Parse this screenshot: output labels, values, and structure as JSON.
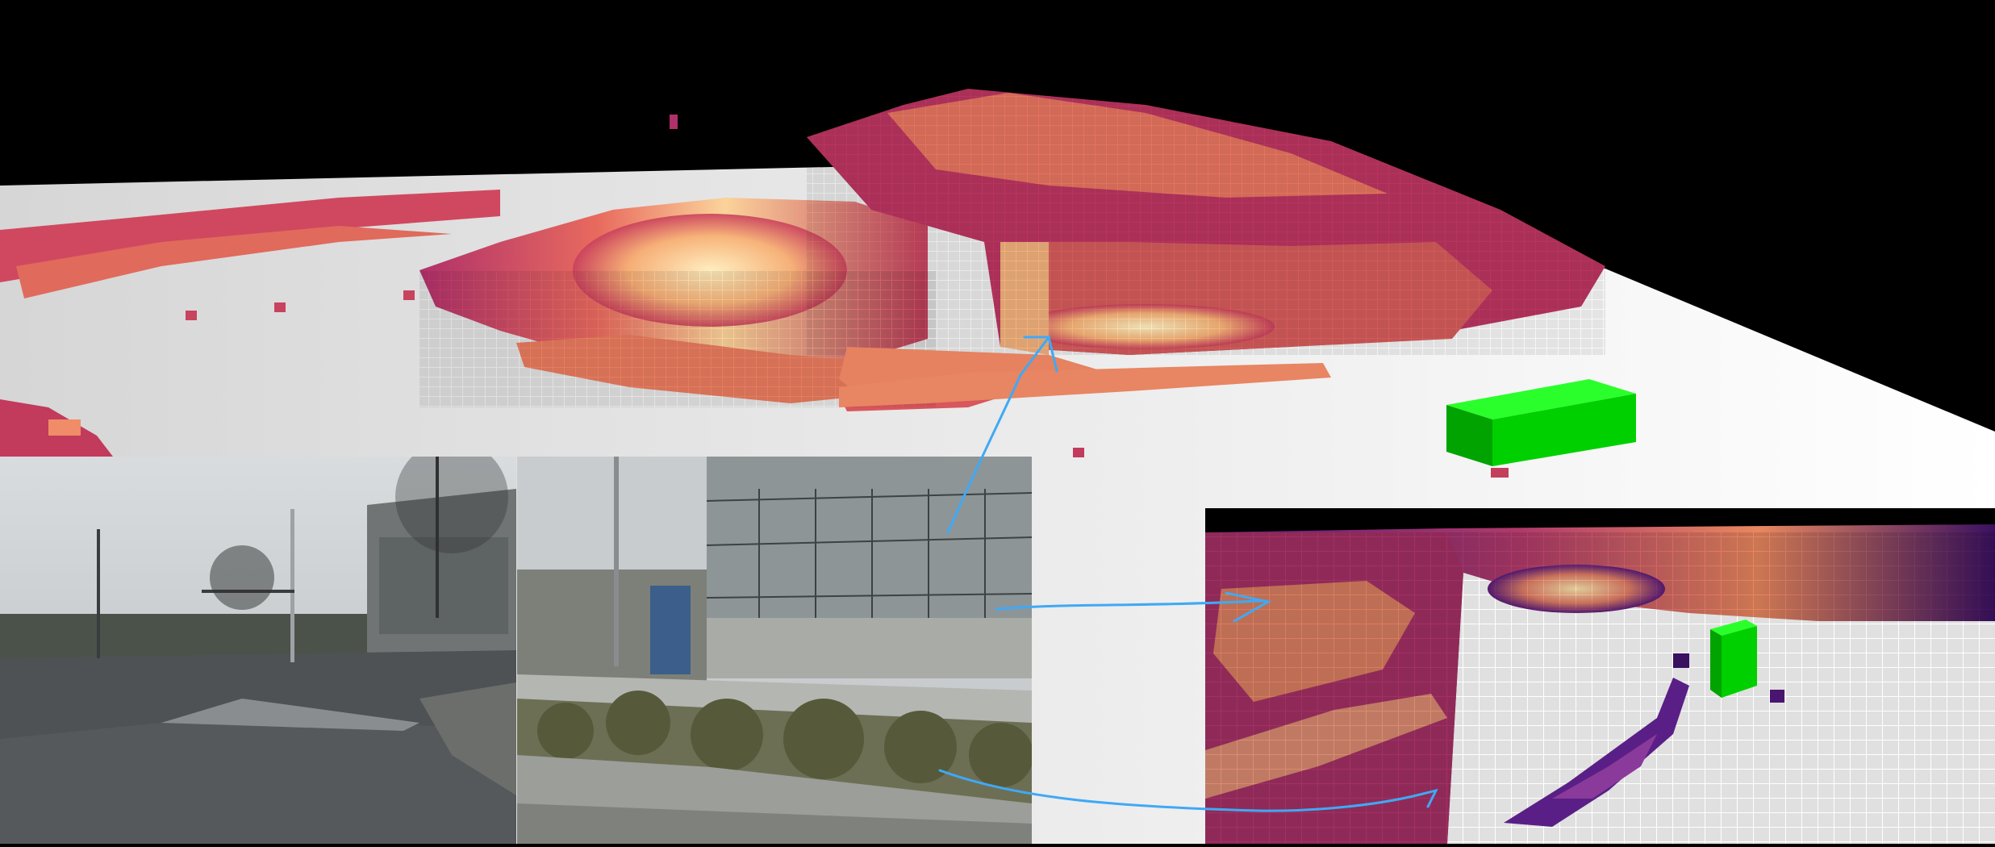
{
  "scene": {
    "background_color": "#000000",
    "ground_color": "#ffffff",
    "occupancy_colormap": [
      "#2a0a4a",
      "#6b1d7a",
      "#b0306a",
      "#e05a5a",
      "#f59a6a",
      "#fde3a8"
    ],
    "box_color": "#00e600",
    "annotation_color": "#3fa9f5"
  },
  "panels": {
    "main_view": "voxel-occupancy-3d",
    "camera_views": [
      "street-camera-view",
      "building-camera-view"
    ],
    "inset_view": "voxel-occupancy-closeup"
  }
}
